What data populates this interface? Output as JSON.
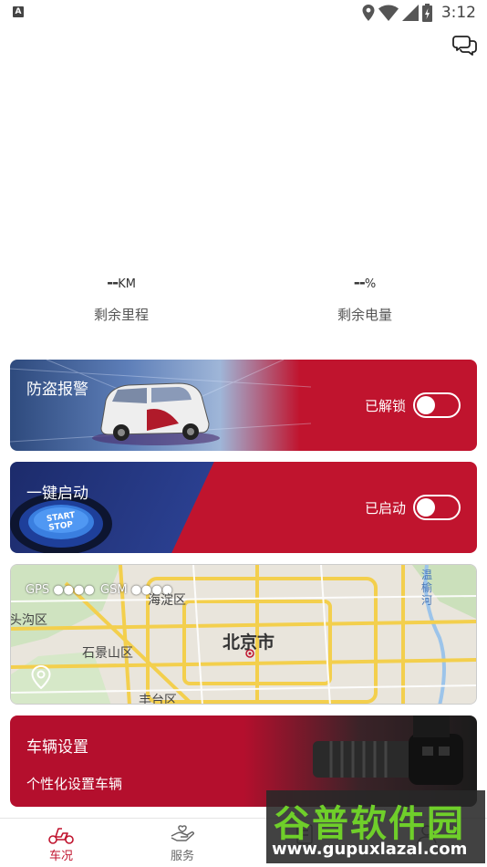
{
  "status_bar": {
    "app_badge": "A",
    "time": "3:12"
  },
  "stats": {
    "mileage": {
      "value": "--",
      "unit": "KM",
      "label": "剩余里程"
    },
    "battery": {
      "value": "--",
      "unit": "%",
      "label": "剩余电量"
    }
  },
  "cards": {
    "alarm": {
      "title": "防盗报警",
      "state_label": "已解锁",
      "toggle_on": false
    },
    "start": {
      "title": "一键启动",
      "state_label": "已启动",
      "toggle_on": false,
      "button_text": "START STOP"
    },
    "map": {
      "gps_label": "GPS",
      "gsm_label": "GSM",
      "signal_dots": "●●●●",
      "city": "北京市",
      "districts": [
        "海淀区",
        "石景山区",
        "丰台区",
        "头沟区"
      ],
      "river": "温榆河"
    },
    "settings": {
      "title": "车辆设置",
      "subtitle": "个性化设置车辆"
    }
  },
  "bottom_nav": [
    {
      "label": "车况",
      "icon": "scooter-icon",
      "active": true
    },
    {
      "label": "服务",
      "icon": "hand-service-icon",
      "active": false
    },
    {
      "label": "",
      "icon": "document-icon",
      "active": false
    },
    {
      "label": "",
      "icon": "user-icon",
      "active": false
    }
  ],
  "watermark": {
    "title": "谷普软件园",
    "url": "www.gupuxlazal.com"
  },
  "colors": {
    "brand_red": "#c0142e",
    "nav_active": "#c0142e",
    "nav_inactive": "#666666"
  }
}
